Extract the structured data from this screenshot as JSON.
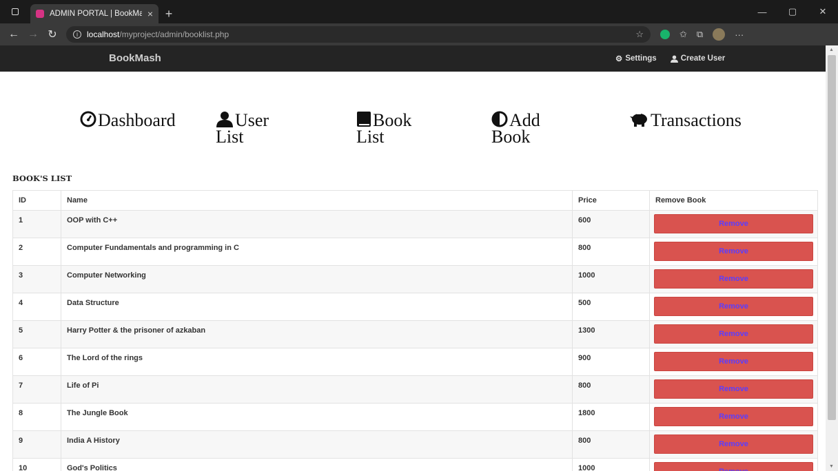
{
  "browser": {
    "tab_title": "ADMIN PORTAL | BookMash",
    "url_host": "localhost",
    "url_path": "/myproject/admin/booklist.php"
  },
  "header": {
    "brand": "BookMash",
    "settings_label": "Settings",
    "create_user_label": "Create User"
  },
  "nav": {
    "dashboard": "Dashboard",
    "user_list": "User List",
    "book_list": "Book List",
    "add_book": "Add Book",
    "transactions": "Transactions"
  },
  "section_title": "BOOK'S LIST",
  "table": {
    "headers": [
      "ID",
      "Name",
      "Price",
      "Remove Book"
    ],
    "remove_label": "Remove",
    "rows": [
      {
        "id": "1",
        "name": "OOP with C++",
        "price": "600"
      },
      {
        "id": "2",
        "name": "Computer Fundamentals and programming in C",
        "price": "800"
      },
      {
        "id": "3",
        "name": "Computer Networking",
        "price": "1000"
      },
      {
        "id": "4",
        "name": "Data Structure",
        "price": "500"
      },
      {
        "id": "5",
        "name": "Harry Potter & the prisoner of azkaban",
        "price": "1300"
      },
      {
        "id": "6",
        "name": "The Lord of the rings",
        "price": "900"
      },
      {
        "id": "7",
        "name": "Life of Pi",
        "price": "800"
      },
      {
        "id": "8",
        "name": "The Jungle Book",
        "price": "1800"
      },
      {
        "id": "9",
        "name": "India A History",
        "price": "800"
      },
      {
        "id": "10",
        "name": "God's Politics",
        "price": "1000"
      }
    ]
  },
  "colors": {
    "header_bg": "#242424",
    "remove_bg": "#d9534f",
    "remove_text": "#5a3dff"
  }
}
